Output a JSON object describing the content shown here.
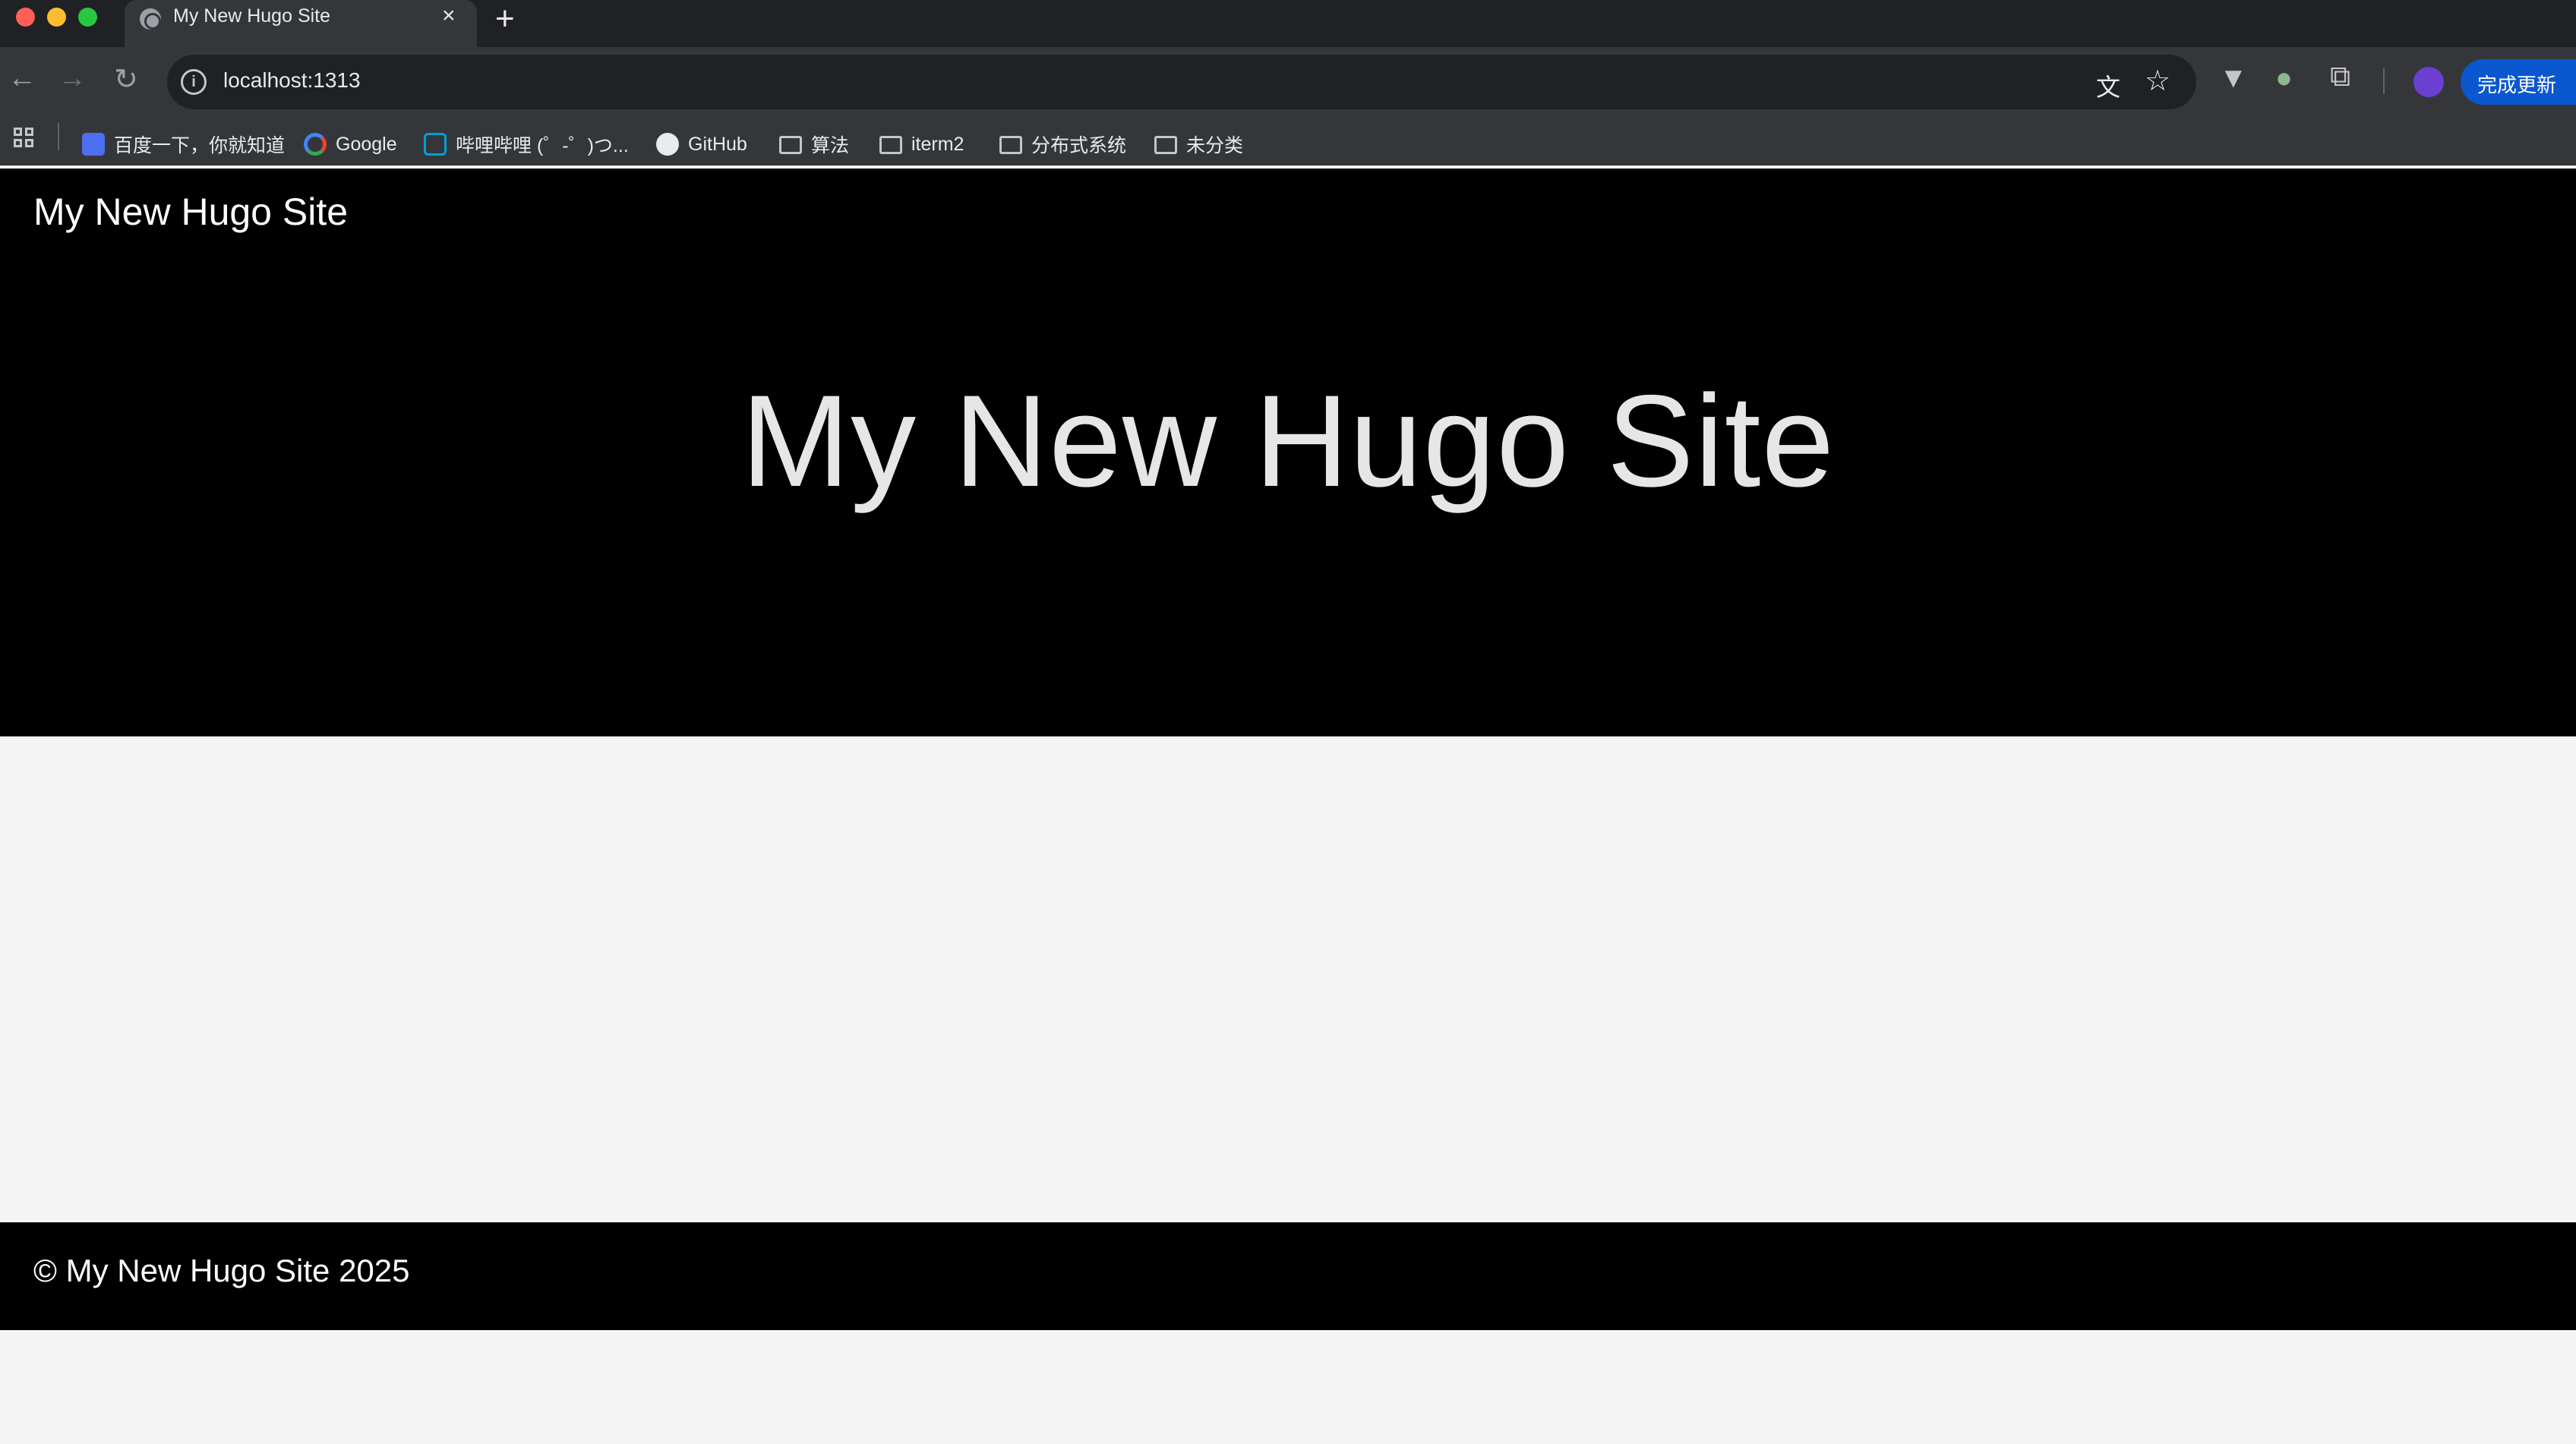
{
  "browser": {
    "tab": {
      "title": "My New Hugo Site",
      "close_glyph": "×"
    },
    "new_tab_glyph": "+",
    "url": "localhost:1313",
    "update_button": "完成更新",
    "bookmarks": [
      {
        "label": "百度一下，你就知道",
        "icon": "baidu-icon"
      },
      {
        "label": "Google",
        "icon": "google-icon"
      },
      {
        "label": "哔哩哔哩 (゜-゜)つ...",
        "icon": "bilibili-icon"
      },
      {
        "label": "GitHub",
        "icon": "github-icon"
      },
      {
        "label": "算法",
        "icon": "folder-icon"
      },
      {
        "label": "iterm2",
        "icon": "folder-icon"
      },
      {
        "label": "分布式系统",
        "icon": "folder-icon"
      },
      {
        "label": "未分类",
        "icon": "folder-icon"
      }
    ]
  },
  "site": {
    "brand": "My New Hugo Site",
    "hero_title": "My New Hugo Site",
    "footer": "© My New Hugo Site 2025"
  },
  "colors": {
    "hero_bg": "#000000",
    "page_bg": "#f4f4f4",
    "chrome_bg": "#35363a",
    "update_button": "#0b57d0"
  }
}
